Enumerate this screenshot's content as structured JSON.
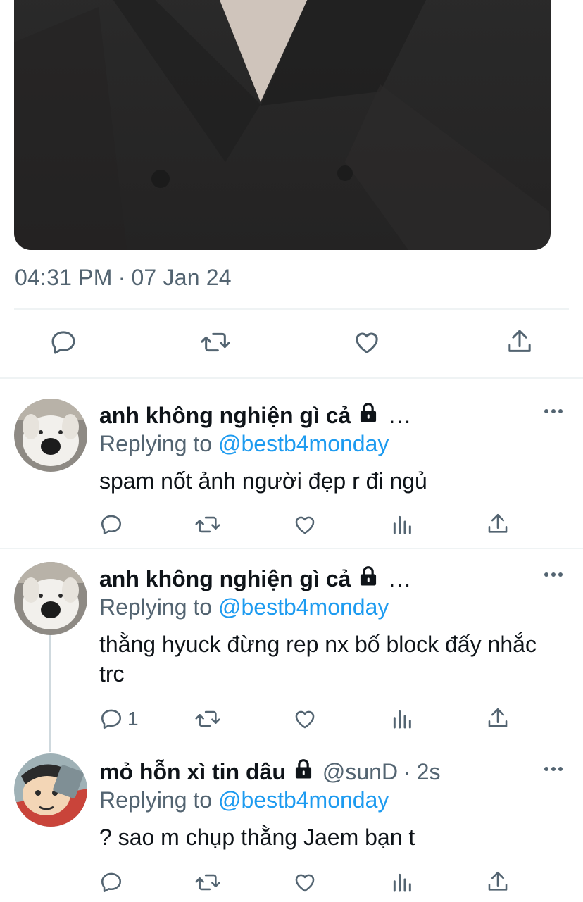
{
  "tweet": {
    "time": "04:31 PM",
    "separator": "·",
    "date": "07 Jan 24"
  },
  "icons": {
    "reply": "reply-icon",
    "retweet": "retweet-icon",
    "like": "heart-icon",
    "share": "share-icon",
    "views": "views-icon",
    "more": "more-icon",
    "lock": "lock-icon"
  },
  "colors": {
    "link": "#1d9bf0",
    "muted": "#536471",
    "text": "#0f1419"
  },
  "replies": [
    {
      "name": "anh không nghiện gì cả",
      "name_overflow": "...",
      "replying_prefix": "Replying to",
      "mention": "@bestb4monday",
      "text": "spam nốt ảnh người đẹp r đi ngủ",
      "reply_count": ""
    },
    {
      "name": "anh không nghiện gì cả",
      "name_overflow": "...",
      "replying_prefix": "Replying to",
      "mention": "@bestb4monday",
      "text": "thằng hyuck đừng rep nx bố block đấy nhắc trc",
      "reply_count": "1"
    },
    {
      "name": "mỏ hỗn xì tin dâu",
      "handle": "@sunD",
      "separator": "·",
      "time": "2s",
      "replying_prefix": "Replying to",
      "mention": "@bestb4monday",
      "text": "? sao m chụp thằng Jaem bạn t",
      "reply_count": ""
    }
  ]
}
